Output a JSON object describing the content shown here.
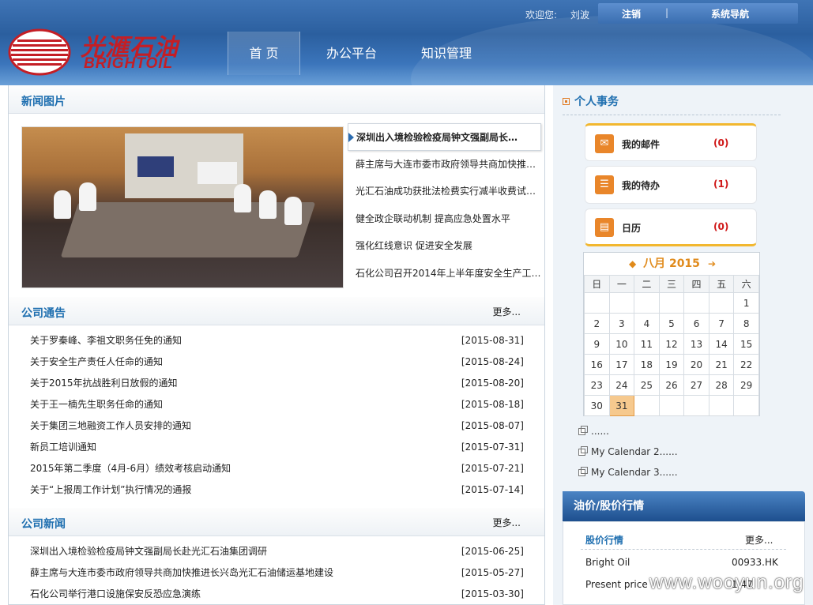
{
  "topbar": {
    "welcome": "欢迎您:",
    "username": "刘波",
    "logout": "注销",
    "separator": "|",
    "sys_nav": "系统导航"
  },
  "logo": {
    "cn": "光滙石油",
    "en": "BRIGHTOIL"
  },
  "nav": {
    "home": "首 页",
    "office": "办公平台",
    "km": "知识管理"
  },
  "news_pics": {
    "title": "新闻图片",
    "items": [
      "深圳出入境检验检疫局钟文强副局长…",
      "薛主席与大连市委市政府领导共商加快推…",
      "光汇石油成功获批法检费实行减半收费试…",
      "健全政企联动机制 提高应急处置水平",
      "强化红线意识 促进安全发展",
      "石化公司召开2014年上半年度安全生产工…"
    ]
  },
  "notices": {
    "title": "公司通告",
    "more": "更多...",
    "rows": [
      {
        "t": "关于罗秦峰、李祖文职务任免的通知",
        "d": "[2015-08-31]"
      },
      {
        "t": "关于安全生产责任人任命的通知",
        "d": "[2015-08-24]"
      },
      {
        "t": "关于2015年抗战胜利日放假的通知",
        "d": "[2015-08-20]"
      },
      {
        "t": "关于王一楠先生职务任命的通知",
        "d": "[2015-08-18]"
      },
      {
        "t": "关于集团三地融资工作人员安排的通知",
        "d": "[2015-08-07]"
      },
      {
        "t": "新员工培训通知",
        "d": "[2015-07-31]"
      },
      {
        "t": "2015年第二季度（4月-6月）绩效考核启动通知",
        "d": "[2015-07-21]"
      },
      {
        "t": "关于“上报周工作计划”执行情况的通报",
        "d": "[2015-07-14]"
      }
    ]
  },
  "company_news": {
    "title": "公司新闻",
    "more": "更多...",
    "rows": [
      {
        "t": "深圳出入境检验检疫局钟文强副局长赴光汇石油集团调研",
        "d": "[2015-06-25]"
      },
      {
        "t": "薛主席与大连市委市政府领导共商加快推进长兴岛光汇石油储运基地建设",
        "d": "[2015-05-27]"
      },
      {
        "t": "石化公司举行港口设施保安反恐应急演练",
        "d": "[2015-03-30]"
      }
    ]
  },
  "personal": {
    "title": "个人事务",
    "mail": {
      "label": "我的邮件",
      "count": "(0)"
    },
    "todo": {
      "label": "我的待办",
      "count": "(1)"
    },
    "calendar": {
      "label": "日历",
      "count": "(0)"
    }
  },
  "calendar": {
    "month": "八月 2015",
    "weekdays": [
      "日",
      "一",
      "二",
      "三",
      "四",
      "五",
      "六"
    ],
    "weeks": [
      [
        "",
        "",
        "",
        "",
        "",
        "",
        "1"
      ],
      [
        "2",
        "3",
        "4",
        "5",
        "6",
        "7",
        "8"
      ],
      [
        "9",
        "10",
        "11",
        "12",
        "13",
        "14",
        "15"
      ],
      [
        "16",
        "17",
        "18",
        "19",
        "20",
        "21",
        "22"
      ],
      [
        "23",
        "24",
        "25",
        "26",
        "27",
        "28",
        "29"
      ],
      [
        "30",
        "31",
        "",
        "",
        "",
        "",
        ""
      ]
    ],
    "today": "31",
    "links": [
      "......",
      "My Calendar 2......",
      "My Calendar 3......"
    ]
  },
  "oil": {
    "title": "油价/股价行情",
    "stock_title": "股价行情",
    "more": "更多...",
    "rows": [
      {
        "k": "Bright Oil",
        "v": "00933.HK"
      },
      {
        "k": "Present price",
        "v": "1.47"
      }
    ]
  },
  "watermark": "www.wooyun.org"
}
